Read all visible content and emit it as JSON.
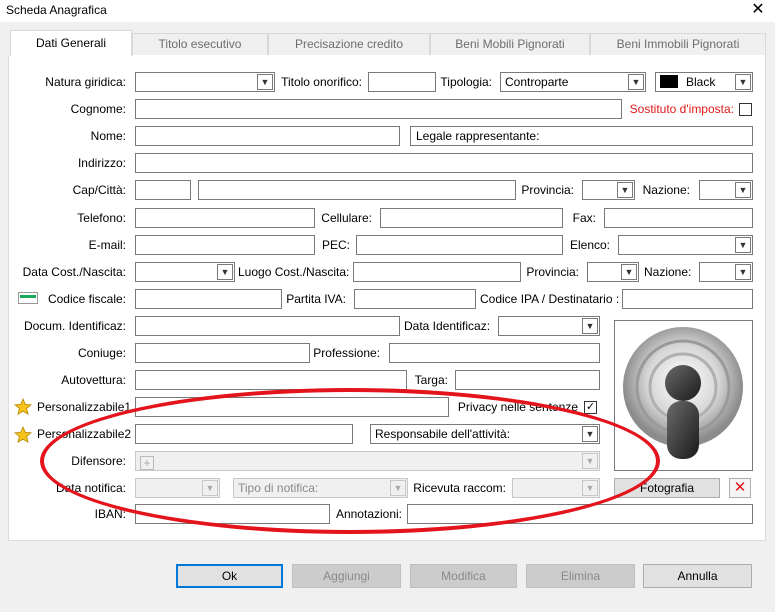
{
  "window": {
    "title": "Scheda Anagrafica",
    "close_glyph": "✕"
  },
  "tabs": [
    {
      "label": "Dati Generali",
      "active": true
    },
    {
      "label": "Titolo esecutivo"
    },
    {
      "label": "Precisazione credito"
    },
    {
      "label": "Beni Mobili Pignorati"
    },
    {
      "label": "Beni Immobili Pignorati"
    }
  ],
  "form": {
    "natura_giuridica": {
      "label": "Natura giridica:",
      "value": ""
    },
    "titolo_onorifico": {
      "label": "Titolo onorifico:",
      "value": ""
    },
    "tipologia": {
      "label": "Tipologia:",
      "value": "Controparte"
    },
    "color": {
      "value": "Black",
      "swatch": "#000000"
    },
    "cognome": {
      "label": "Cognome:",
      "value": ""
    },
    "sostituto_imposta": {
      "label": "Sostituto d'imposta:",
      "checked": false
    },
    "nome": {
      "label": "Nome:",
      "value": ""
    },
    "legale_rappresentante": {
      "label": "Legale rappresentante:"
    },
    "indirizzo": {
      "label": "Indirizzo:",
      "value": ""
    },
    "cap_citta": {
      "label": "Cap/Città:"
    },
    "provincia": {
      "label": "Provincia:"
    },
    "nazione": {
      "label": "Nazione:"
    },
    "telefono": {
      "label": "Telefono:"
    },
    "cellulare": {
      "label": "Cellulare:"
    },
    "fax": {
      "label": "Fax:"
    },
    "email": {
      "label": "E-mail:"
    },
    "pec": {
      "label": "PEC:"
    },
    "elenco": {
      "label": "Elenco:"
    },
    "data_nascita": {
      "label": "Data Cost./Nascita:"
    },
    "luogo_nascita": {
      "label": "Luogo Cost./Nascita:"
    },
    "provincia2": {
      "label": "Provincia:"
    },
    "nazione2": {
      "label": "Nazione:"
    },
    "codice_fiscale": {
      "label": "Codice fiscale:"
    },
    "partita_iva": {
      "label": "Partita IVA:"
    },
    "codice_ipa": {
      "label": "Codice IPA / Destinatario :"
    },
    "documento": {
      "label": "Docum. Identificaz:"
    },
    "data_identificaz": {
      "label": "Data Identificaz:"
    },
    "coniuge": {
      "label": "Coniuge:"
    },
    "professione": {
      "label": "Professione:"
    },
    "autovettura": {
      "label": "Autovettura:"
    },
    "targa": {
      "label": "Targa:"
    },
    "personalizzabile1": {
      "label": "Personalizzabile1"
    },
    "privacy": {
      "label": "Privacy nelle sentenze",
      "checked": true,
      "check_glyph": "✓"
    },
    "personalizzabile2": {
      "label": "Personalizzabile2"
    },
    "responsabile": {
      "value": "Responsabile dell'attività:"
    },
    "difensore": {
      "label": "Difensore:"
    },
    "data_notifica": {
      "label": "Data notifica:"
    },
    "tipo_notifica": {
      "placeholder": "Tipo di notifica:"
    },
    "ricevuta_raccom": {
      "label": "Ricevuta raccom:"
    },
    "fotografia": {
      "label": "Fotografia"
    },
    "iban": {
      "label": "IBAN:"
    },
    "annotazioni": {
      "label": "Annotazioni:"
    }
  },
  "buttons": {
    "ok": "Ok",
    "aggiungi": "Aggiungi",
    "modifica": "Modifica",
    "elimina": "Elimina",
    "annulla": "Annulla"
  },
  "colors": {
    "accent": "#0078d7",
    "required_red": "#e01a1a",
    "annotation_ellipse": "#e3141c"
  },
  "icons": [
    "close-icon",
    "card-icon",
    "star-icon",
    "star-icon",
    "add-icon",
    "avatar-placeholder-icon",
    "delete-x-icon",
    "chevron-down-icon"
  ]
}
